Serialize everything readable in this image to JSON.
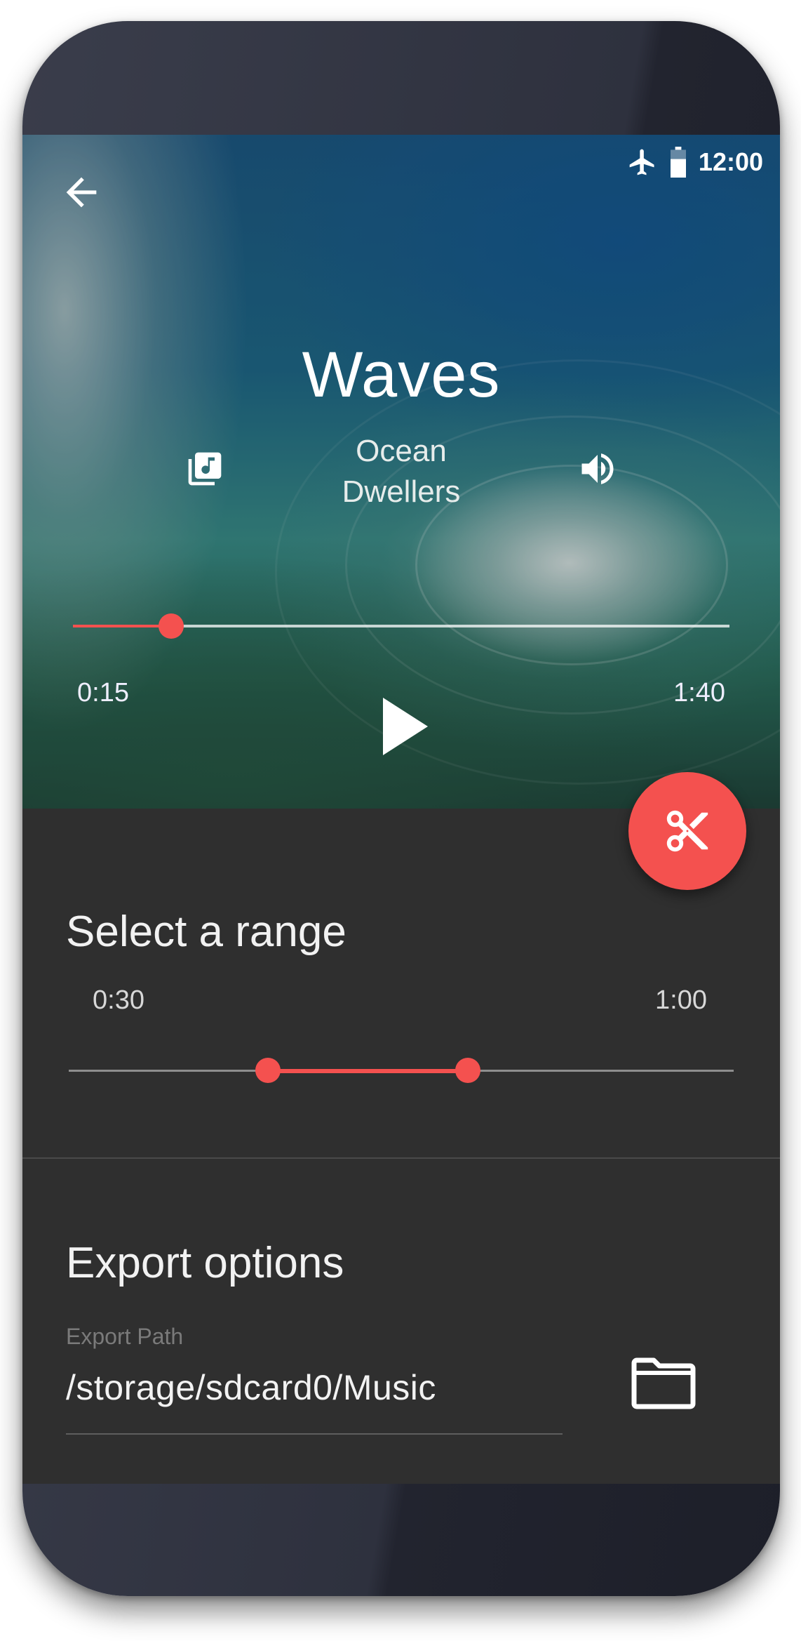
{
  "status_bar": {
    "time": "12:00",
    "icons": [
      "airplane-icon",
      "battery-icon"
    ]
  },
  "player": {
    "title": "Waves",
    "artist": "Ocean Dwellers",
    "elapsed": "0:15",
    "duration": "1:40",
    "progress_fraction": 0.15,
    "icons": {
      "back": "arrow-back-icon",
      "library": "music-library-icon",
      "volume": "volume-icon",
      "play": "play-icon"
    }
  },
  "fab": {
    "icon": "scissors-icon"
  },
  "range": {
    "title": "Select a range",
    "start_label": "0:30",
    "end_label": "1:00",
    "start_fraction": 0.3,
    "end_fraction": 0.6
  },
  "export": {
    "title": "Export options",
    "path_label": "Export Path",
    "path_value": "/storage/sdcard0/Music",
    "icon": "folder-icon"
  },
  "colors": {
    "accent": "#f4514f",
    "surface": "#2f2f2f",
    "text": "#f2f2f2",
    "muted": "#7a7a7a"
  }
}
